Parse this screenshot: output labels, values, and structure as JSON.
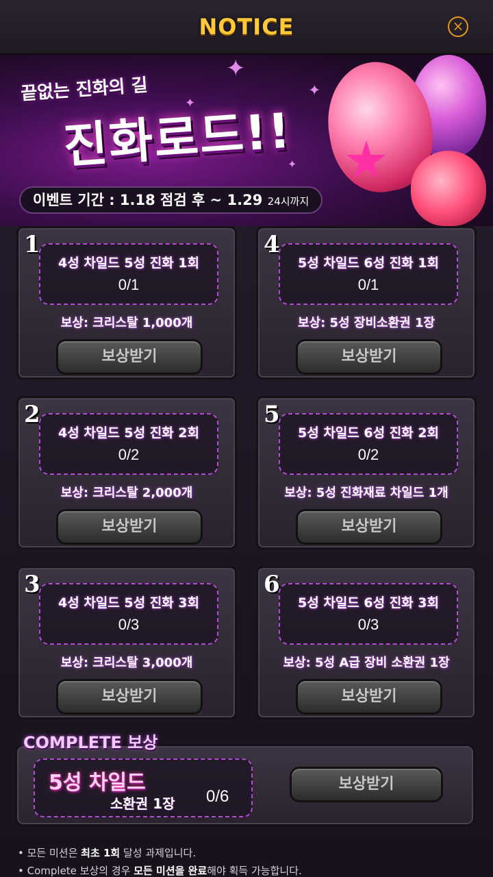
{
  "header": {
    "title": "NOTICE",
    "close_symbol": "×"
  },
  "banner": {
    "subtitle": "끝없는 진화의 길",
    "title": "진화로드!!",
    "period_label": "이벤트 기간 : 1.18 점검 후 ~ 1.29",
    "period_suffix": "24시까지"
  },
  "missions": [
    {
      "num": "1",
      "desc": "4성 차일드 5성 진화 1회",
      "progress": "0/1",
      "reward": "보상: 크리스탈 1,000개",
      "button": "보상받기"
    },
    {
      "num": "4",
      "desc": "5성 차일드 6성 진화 1회",
      "progress": "0/1",
      "reward": "보상: 5성 장비소환권 1장",
      "button": "보상받기"
    },
    {
      "num": "2",
      "desc": "4성 차일드 5성 진화 2회",
      "progress": "0/2",
      "reward": "보상: 크리스탈 2,000개",
      "button": "보상받기"
    },
    {
      "num": "5",
      "desc": "5성 차일드 6성 진화 2회",
      "progress": "0/2",
      "reward": "보상: 5성 진화재료 차일드 1개",
      "button": "보상받기"
    },
    {
      "num": "3",
      "desc": "4성 차일드 5성 진화 3회",
      "progress": "0/3",
      "reward": "보상: 크리스탈 3,000개",
      "button": "보상받기"
    },
    {
      "num": "6",
      "desc": "5성 차일드 6성 진화 3회",
      "progress": "0/3",
      "reward": "보상: 5성 A급 장비 소환권 1장",
      "button": "보상받기"
    }
  ],
  "complete": {
    "label": "COMPLETE 보상",
    "reward_main": "5성 차일드",
    "reward_sub": "소환권 1장",
    "progress": "0/6",
    "button": "보상받기"
  },
  "notes": {
    "line1_pre": "• 모든 미션은 ",
    "line1_bold": "최초 1회",
    "line1_post": " 달성 과제입니다.",
    "line2_pre": "• Complete 보상의 경우 ",
    "line2_bold": "모든 미션을 완료",
    "line2_post": "해야 획득 가능합니다."
  },
  "colors": {
    "accent_gold": "#ffc93a",
    "accent_purple": "#b34dd6",
    "button_gray": "#3a3a3a"
  }
}
